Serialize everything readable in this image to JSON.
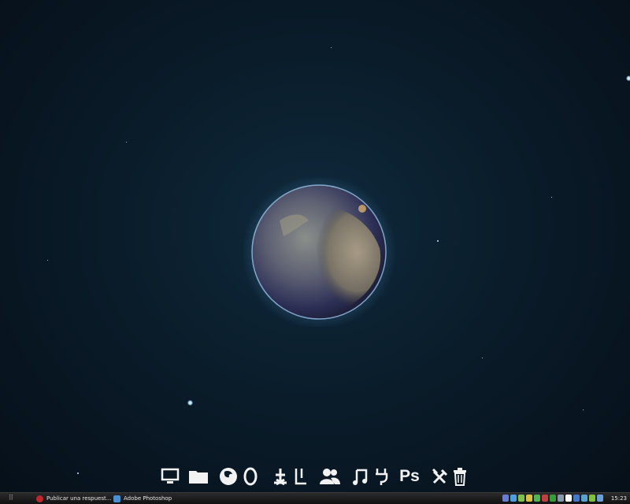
{
  "taskbar": {
    "start_glyph": "⠿",
    "tasks": [
      {
        "label": "Publicar una respuest...",
        "icon": "opera-icon",
        "color": "#c0262d"
      },
      {
        "label": "Adobe Photoshop",
        "icon": "photoshop-icon",
        "color": "#4a8fd0"
      }
    ],
    "tray_colors": [
      "#6a7ccf",
      "#4da0e0",
      "#7ec050",
      "#d8c040",
      "#52b452",
      "#c04040",
      "#3a9a3a",
      "#8899aa",
      "#ffffff",
      "#4477cc",
      "#5aa0d0",
      "#80c040",
      "#6aa0d8"
    ],
    "clock": "15:23"
  },
  "dock": {
    "items": [
      {
        "name": "computer-icon"
      },
      {
        "name": "folder-icon"
      },
      {
        "name": "firefox-icon"
      },
      {
        "name": "opera-icon"
      },
      {
        "name": "anchor-icon"
      },
      {
        "name": "utorrent-icon"
      },
      {
        "name": "messenger-icon"
      },
      {
        "name": "music-icon"
      },
      {
        "name": "plug-icon"
      },
      {
        "name": "photoshop-icon",
        "text": "Ps"
      },
      {
        "name": "tools-icon"
      },
      {
        "name": "trash-icon"
      }
    ]
  },
  "colors": {
    "icon_fg": "#f2f2f2",
    "space": "#0a1c2a",
    "taskbar": "#1a1a1a"
  }
}
